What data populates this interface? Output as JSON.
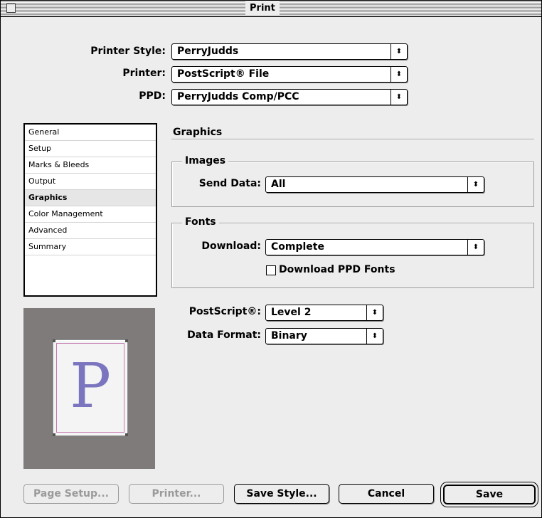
{
  "window": {
    "title": "Print"
  },
  "top_fields": {
    "printer_style": {
      "label": "Printer Style:",
      "value": "PerryJudds"
    },
    "printer": {
      "label": "Printer:",
      "value": "PostScript® File"
    },
    "ppd": {
      "label": "PPD:",
      "value": "PerryJudds Comp/PCC"
    }
  },
  "sidebar": {
    "items": [
      {
        "label": "General"
      },
      {
        "label": "Setup"
      },
      {
        "label": "Marks & Bleeds"
      },
      {
        "label": "Output"
      },
      {
        "label": "Graphics",
        "selected": true
      },
      {
        "label": "Color Management"
      },
      {
        "label": "Advanced"
      },
      {
        "label": "Summary"
      }
    ]
  },
  "preview": {
    "letter": "P"
  },
  "graphics": {
    "section_title": "Graphics",
    "images": {
      "legend": "Images",
      "send_data_label": "Send Data:",
      "send_data_value": "All"
    },
    "fonts": {
      "legend": "Fonts",
      "download_label": "Download:",
      "download_value": "Complete",
      "download_ppd_fonts_label": "Download PPD Fonts",
      "download_ppd_fonts_checked": false
    },
    "postscript_label": "PostScript®:",
    "postscript_value": "Level 2",
    "data_format_label": "Data Format:",
    "data_format_value": "Binary"
  },
  "buttons": {
    "page_setup": "Page Setup...",
    "printer": "Printer...",
    "save_style": "Save Style...",
    "cancel": "Cancel",
    "save": "Save"
  },
  "icons": {
    "popup_arrow": "up-down-arrows-icon"
  },
  "colors": {
    "preview_bg": "#807b7b",
    "preview_letter": "#7b75bf",
    "margin_guide": "#c47ab0"
  }
}
